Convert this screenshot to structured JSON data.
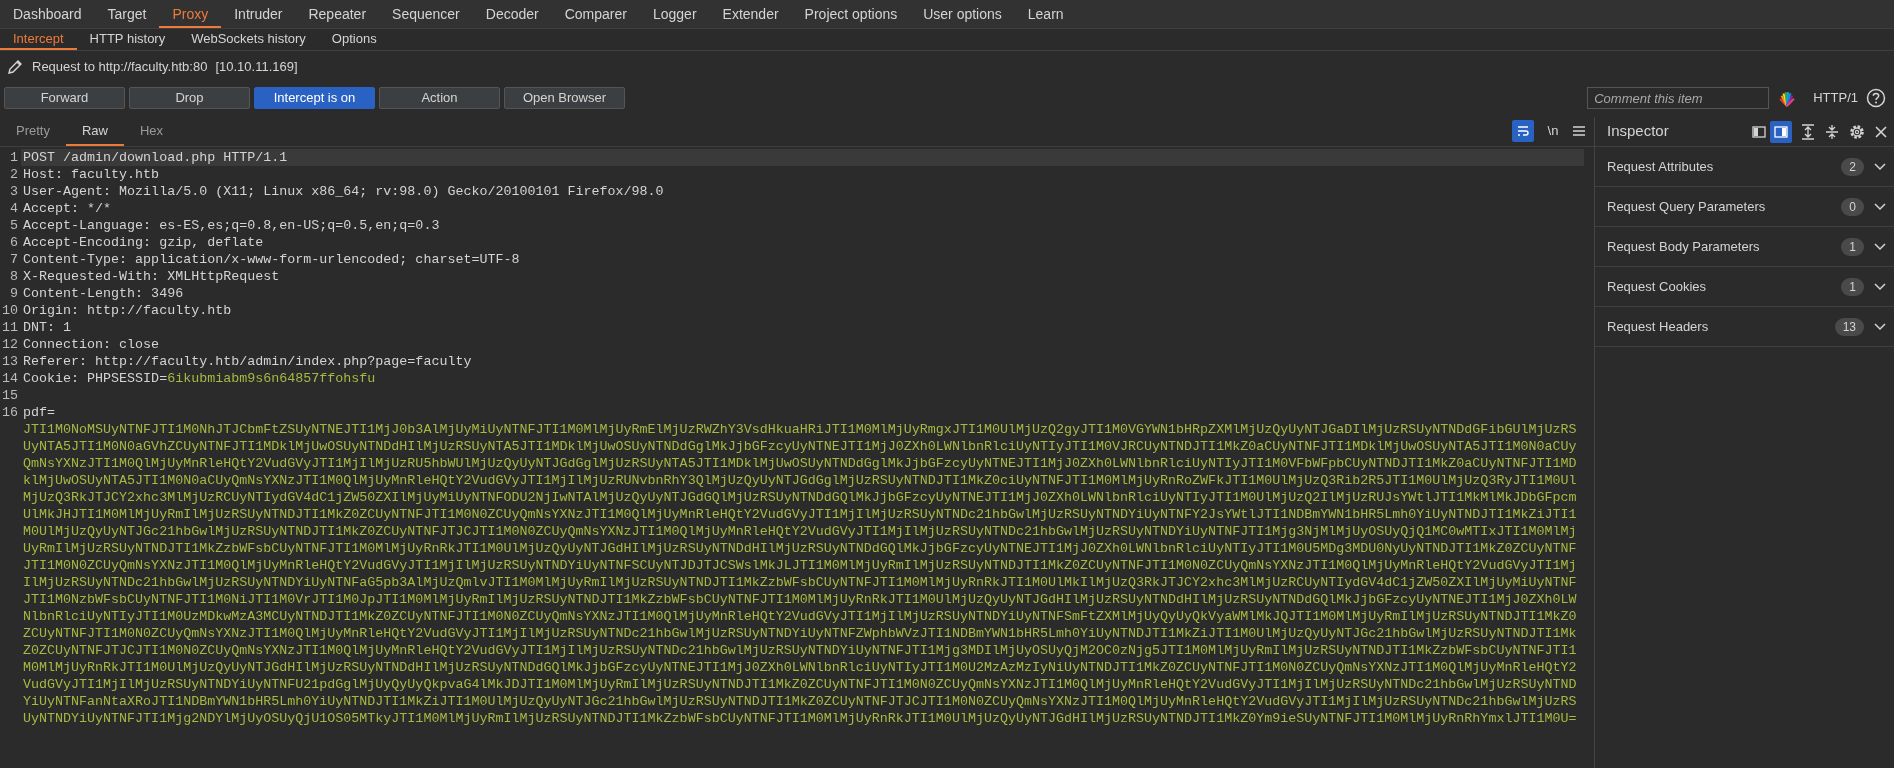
{
  "top_tabs": [
    {
      "label": "Dashboard",
      "selected": false
    },
    {
      "label": "Target",
      "selected": false
    },
    {
      "label": "Proxy",
      "selected": true
    },
    {
      "label": "Intruder",
      "selected": false
    },
    {
      "label": "Repeater",
      "selected": false
    },
    {
      "label": "Sequencer",
      "selected": false
    },
    {
      "label": "Decoder",
      "selected": false
    },
    {
      "label": "Comparer",
      "selected": false
    },
    {
      "label": "Logger",
      "selected": false
    },
    {
      "label": "Extender",
      "selected": false
    },
    {
      "label": "Project options",
      "selected": false
    },
    {
      "label": "User options",
      "selected": false
    },
    {
      "label": "Learn",
      "selected": false
    }
  ],
  "sub_tabs": [
    {
      "label": "Intercept",
      "selected": true
    },
    {
      "label": "HTTP history",
      "selected": false
    },
    {
      "label": "WebSockets history",
      "selected": false
    },
    {
      "label": "Options",
      "selected": false
    }
  ],
  "request_info": {
    "label": "Request to http://faculty.htb:80",
    "ip": "[10.10.11.169]"
  },
  "actions": [
    {
      "label": "Forward",
      "active": false
    },
    {
      "label": "Drop",
      "active": false
    },
    {
      "label": "Intercept is on",
      "active": true
    },
    {
      "label": "Action",
      "active": false
    },
    {
      "label": "Open Browser",
      "active": false
    }
  ],
  "comment": {
    "placeholder": "Comment this item"
  },
  "protocol": "HTTP/1",
  "editor_tabs": [
    {
      "label": "Pretty",
      "selected": false
    },
    {
      "label": "Raw",
      "selected": true
    },
    {
      "label": "Hex",
      "selected": false
    }
  ],
  "word_wrap": true,
  "newline_toggle": "\\n",
  "request_lines": [
    {
      "number": "1",
      "kind": "plain",
      "current": true,
      "text": "POST /admin/download.php HTTP/1.1"
    },
    {
      "number": "2",
      "kind": "plain",
      "current": false,
      "text": "Host: faculty.htb"
    },
    {
      "number": "3",
      "kind": "plain",
      "current": false,
      "text": "User-Agent: Mozilla/5.0 (X11; Linux x86_64; rv:98.0) Gecko/20100101 Firefox/98.0"
    },
    {
      "number": "4",
      "kind": "plain",
      "current": false,
      "text": "Accept: */*"
    },
    {
      "number": "5",
      "kind": "plain",
      "current": false,
      "text": "Accept-Language: es-ES,es;q=0.8,en-US;q=0.5,en;q=0.3"
    },
    {
      "number": "6",
      "kind": "plain",
      "current": false,
      "text": "Accept-Encoding: gzip, deflate"
    },
    {
      "number": "7",
      "kind": "plain",
      "current": false,
      "text": "Content-Type: application/x-www-form-urlencoded; charset=UTF-8"
    },
    {
      "number": "8",
      "kind": "plain",
      "current": false,
      "text": "X-Requested-With: XMLHttpRequest"
    },
    {
      "number": "9",
      "kind": "plain",
      "current": false,
      "text": "Content-Length: 3496"
    },
    {
      "number": "10",
      "kind": "plain",
      "current": false,
      "text": "Origin: http://faculty.htb"
    },
    {
      "number": "11",
      "kind": "plain",
      "current": false,
      "text": "DNT: 1"
    },
    {
      "number": "12",
      "kind": "plain",
      "current": false,
      "text": "Connection: close"
    },
    {
      "number": "13",
      "kind": "plain",
      "current": false,
      "text": "Referer: http://faculty.htb/admin/index.php?page=faculty"
    },
    {
      "number": "14",
      "kind": "param",
      "current": false,
      "text": "Cookie: PHPSESSID=",
      "value": "6ikubmiabm9s6n64857ffohsfu"
    },
    {
      "number": "15",
      "kind": "plain",
      "current": false
    },
    {
      "number": "16",
      "kind": "body",
      "current": false,
      "text": "pdf=",
      "value_lines": [
        "JTI1M0NoMSUyNTNFJTI1M0NhJTJCbmFtZSUyNTNEJTI1MjJ0b3AlMjUyMiUyNTNFJTI1M0MlMjUyRmElMjUzRWZhY3VsdHkuaHRiJTI1M0MlMjUyRmgxJTI1M0UlMjUzQ2gyJTI1M0VGYWN1bHRpZXMlMjUzQyUyNTJGaDIlMjUzRSUyNTNDdGFibGUlMjUzRS",
        "UyNTA5JTI1M0N0aGVhZCUyNTNFJTI1MDklMjUwOSUyNTNDdHIlMjUzRSUyNTA5JTI1MDklMjUwOSUyNTNDdGglMkJjbGFzcyUyNTNEJTI1MjJ0ZXh0LWNlbnRlciUyNTIyJTI1M0VJRCUyNTNDJTI1MkZ0aCUyNTNFJTI1MDklMjUwOSUyNTA5JTI1M0N0aCUy",
        "QmNsYXNzJTI1M0QlMjUyMnRleHQtY2VudGVyJTI1MjIlMjUzRU5hbWUlMjUzQyUyNTJGdGglMjUzRSUyNTA5JTI1MDklMjUwOSUyNTNDdGglMkJjbGFzcyUyNTNEJTI1MjJ0ZXh0LWNlbnRlciUyNTIyJTI1M0VFbWFpbCUyNTNDJTI1MkZ0aCUyNTNFJTI1MD",
        "klMjUwOSUyNTA5JTI1M0N0aCUyQmNsYXNzJTI1M0QlMjUyMnRleHQtY2VudGVyJTI1MjIlMjUzRUNvbnRhY3QlMjUzQyUyNTJGdGglMjUzRSUyNTNDJTI1MkZ0ciUyNTNFJTI1M0MlMjUyRnRoZWFkJTI1M0UlMjUzQ3Rib2R5JTI1M0UlMjUzQ3RyJTI1M0Ul",
        "MjUzQ3RkJTJCY2xhc3MlMjUzRCUyNTIydGV4dC1jZW50ZXIlMjUyMiUyNTNFODU2NjIwNTAlMjUzQyUyNTJGdGQlMjUzRSUyNTNDdGQlMkJjbGFzcyUyNTNEJTI1MjJ0ZXh0LWNlbnRlciUyNTIyJTI1M0UlMjUzQ2IlMjUzRUJsYWtlJTI1MkMlMkJDbGFpcm",
        "UlMkJHJTI1M0MlMjUyRmIlMjUzRSUyNTNDJTI1MkZ0ZCUyNTNFJTI1M0N0ZCUyQmNsYXNzJTI1M0QlMjUyMnRleHQtY2VudGVyJTI1MjIlMjUzRSUyNTNDc21hbGwlMjUzRSUyNTNDYiUyNTNFY2JsYWtlJTI1NDBmYWN1bHR5Lmh0YiUyNTNDJTI1MkZiJTI1",
        "M0UlMjUzQyUyNTJGc21hbGwlMjUzRSUyNTNDJTI1MkZ0ZCUyNTNFJTJCJTI1M0N0ZCUyQmNsYXNzJTI1M0QlMjUyMnRleHQtY2VudGVyJTI1MjIlMjUzRSUyNTNDc21hbGwlMjUzRSUyNTNDYiUyNTNFJTI1Mjg3NjMlMjUyOSUyQjQ1MC0wMTIxJTI1M0MlMj",
        "UyRmIlMjUzRSUyNTNDJTI1MkZzbWFsbCUyNTNFJTI1M0MlMjUyRnRkJTI1M0UlMjUzQyUyNTJGdHIlMjUzRSUyNTNDdHIlMjUzRSUyNTNDdGQlMkJjbGFzcyUyNTNEJTI1MjJ0ZXh0LWNlbnRlciUyNTIyJTI1M0U5MDg3MDU0NyUyNTNDJTI1MkZ0ZCUyNTNF",
        "JTI1M0N0ZCUyQmNsYXNzJTI1M0QlMjUyMnRleHQtY2VudGVyJTI1MjIlMjUzRSUyNTNDYiUyNTNFSCUyNTJDJTJCSWslMkJLJTI1M0MlMjUyRmIlMjUzRSUyNTNDJTI1MkZ0ZCUyNTNFJTI1M0N0ZCUyQmNsYXNzJTI1M0QlMjUyMnRleHQtY2VudGVyJTI1Mj",
        "IlMjUzRSUyNTNDc21hbGwlMjUzRSUyNTNDYiUyNTNFaG5pb3AlMjUzQmlvJTI1M0MlMjUyRmIlMjUzRSUyNTNDJTI1MkZzbWFsbCUyNTNFJTI1M0MlMjUyRnRkJTI1M0UlMkIlMjUzQ3RkJTJCY2xhc3MlMjUzRCUyNTIydGV4dC1jZW50ZXIlMjUyMiUyNTNF",
        "JTI1M0NzbWFsbCUyNTNFJTI1M0NiJTI1M0VrJTI1M0JpJTI1M0MlMjUyRmIlMjUzRSUyNTNDJTI1MkZzbWFsbCUyNTNFJTI1M0MlMjUyRnRkJTI1M0UlMjUzQyUyNTJGdHIlMjUzRSUyNTNDdHIlMjUzRSUyNTNDdGQlMkJjbGFzcyUyNTNEJTI1MjJ0ZXh0LW",
        "NlbnRlciUyNTIyJTI1M0UzMDkwMzA3MCUyNTNDJTI1MkZ0ZCUyNTNFJTI1M0N0ZCUyQmNsYXNzJTI1M0QlMjUyMnRleHQtY2VudGVyJTI1MjIlMjUzRSUyNTNDYiUyNTNFSmFtZXMlMjUyQyUyQkVyaWMlMkJQJTI1M0MlMjUyRmIlMjUzRSUyNTNDJTI1MkZ0",
        "ZCUyNTNFJTI1M0N0ZCUyQmNsYXNzJTI1M0QlMjUyMnRleHQtY2VudGVyJTI1MjIlMjUzRSUyNTNDc21hbGwlMjUzRSUyNTNDYiUyNTNFZWphbWVzJTI1NDBmYWN1bHR5Lmh0YiUyNTNDJTI1MkZiJTI1M0UlMjUzQyUyNTJGc21hbGwlMjUzRSUyNTNDJTI1Mk",
        "Z0ZCUyNTNFJTJCJTI1M0N0ZCUyQmNsYXNzJTI1M0QlMjUyMnRleHQtY2VudGVyJTI1MjIlMjUzRSUyNTNDc21hbGwlMjUzRSUyNTNDYiUyNTNFJTI1Mjg3MDIlMjUyOSUyQjM2OC0zNjg5JTI1M0MlMjUyRmIlMjUzRSUyNTNDJTI1MkZzbWFsbCUyNTNFJTI1",
        "M0MlMjUyRnRkJTI1M0UlMjUzQyUyNTJGdHIlMjUzRSUyNTNDdHIlMjUzRSUyNTNDdGQlMkJjbGFzcyUyNTNEJTI1MjJ0ZXh0LWNlbnRlciUyNTIyJTI1M0U2MzAzMzIyNiUyNTNDJTI1MkZ0ZCUyNTNFJTI1M0N0ZCUyQmNsYXNzJTI1M0QlMjUyMnRleHQtY2",
        "VudGVyJTI1MjIlMjUzRSUyNTNDYiUyNTNFU21pdGglMjUyQyUyQkpvaG4lMkJDJTI1M0MlMjUyRmIlMjUzRSUyNTNDJTI1MkZ0ZCUyNTNFJTI1M0N0ZCUyQmNsYXNzJTI1M0QlMjUyMnRleHQtY2VudGVyJTI1MjIlMjUzRSUyNTNDc21hbGwlMjUzRSUyNTND",
        "YiUyNTNFanNtaXRoJTI1NDBmYWN1bHR5Lmh0YiUyNTNDJTI1MkZiJTI1M0UlMjUzQyUyNTJGc21hbGwlMjUzRSUyNTNDJTI1MkZ0ZCUyNTNFJTJCJTI1M0N0ZCUyQmNsYXNzJTI1M0QlMjUyMnRleHQtY2VudGVyJTI1MjIlMjUzRSUyNTNDc21hbGwlMjUzRS",
        "UyNTNDYiUyNTNFJTI1Mjg2NDYlMjUyOSUyQjU1OS05MTkyJTI1M0MlMjUyRmIlMjUzRSUyNTNDJTI1MkZzbWFsbCUyNTNFJTI1M0MlMjUyRnRkJTI1M0UlMjUzQyUyNTJGdHIlMjUzRSUyNTNDJTI1MkZ0Ym9ieSUyNTNFJTI1M0MlMjUyRnRhYmxlJTI1M0U="
      ]
    }
  ],
  "inspector": {
    "title": "Inspector",
    "layout_toggles": [
      {
        "selected": false
      },
      {
        "selected": true
      }
    ],
    "sections": [
      {
        "label": "Request Attributes",
        "count": "2"
      },
      {
        "label": "Request Query Parameters",
        "count": "0"
      },
      {
        "label": "Request Body Parameters",
        "count": "1"
      },
      {
        "label": "Request Cookies",
        "count": "1"
      },
      {
        "label": "Request Headers",
        "count": "13"
      }
    ]
  }
}
